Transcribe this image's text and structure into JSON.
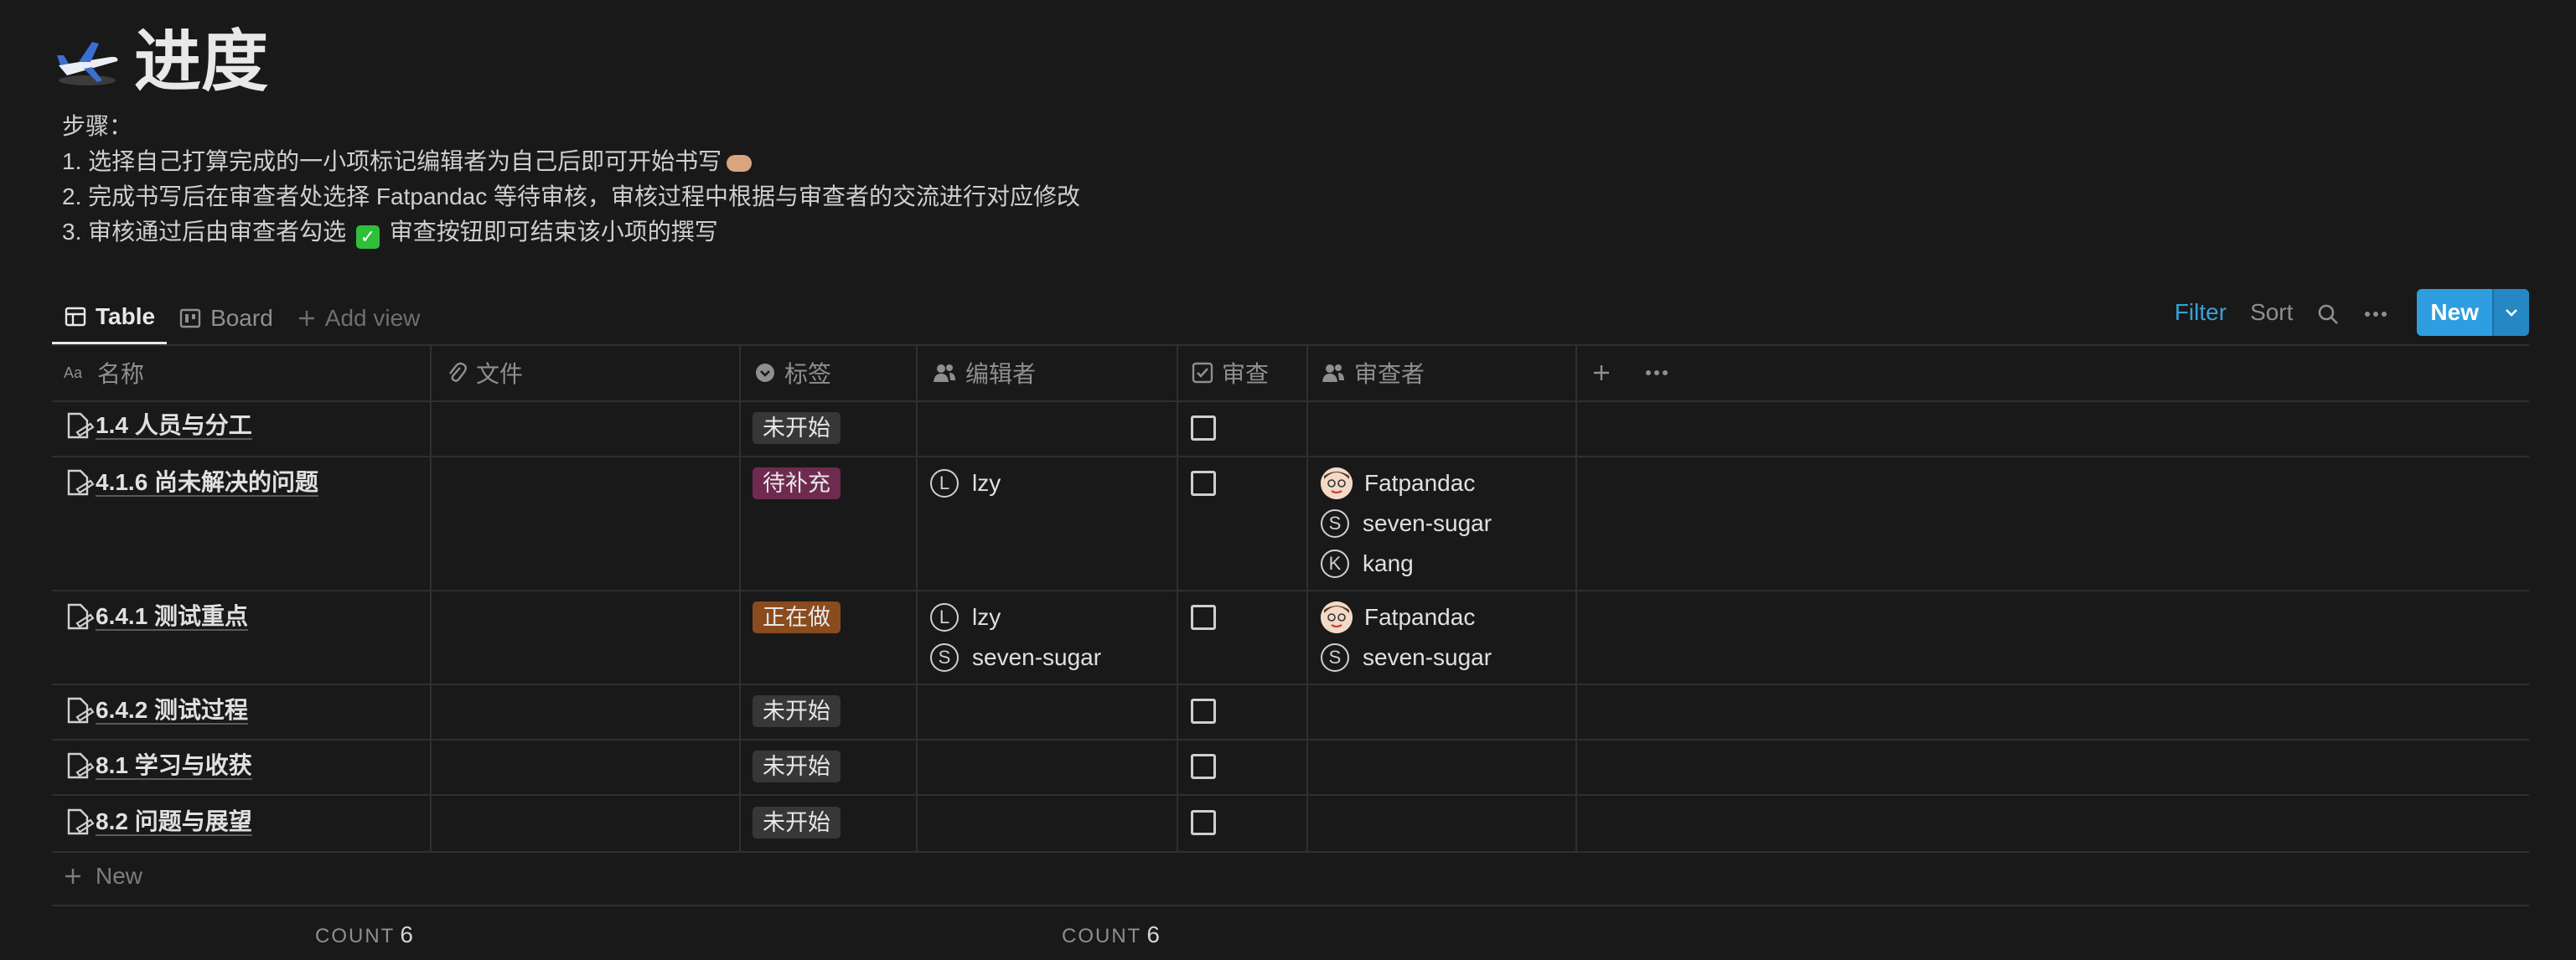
{
  "page": {
    "icon": "airplane-icon",
    "title": "进度",
    "description": {
      "heading": "步骤：",
      "step1": "1. 选择自己打算完成的一小项标记编辑者为自己后即可开始书写",
      "step2": "2. 完成书写后在审查者处选择 Fatpandac 等待审核，审核过程中根据与审查者的交流进行对应修改",
      "step3_a": "3. 审核通过后由审查者勾选",
      "step3_b": "审查按钮即可结束该小项的撰写"
    }
  },
  "views": {
    "table": "Table",
    "board": "Board",
    "add_view": "Add view"
  },
  "toolbar": {
    "filter": "Filter",
    "sort": "Sort",
    "new": "New"
  },
  "columns": {
    "name": "名称",
    "file": "文件",
    "tag": "标签",
    "editor": "编辑者",
    "review": "审查",
    "reviewer": "审查者"
  },
  "tag_colors": {
    "未开始": "#373737",
    "待补充": "#6e2a4f",
    "正在做": "#8a4b1e"
  },
  "rows": [
    {
      "name": "1.4 人员与分工",
      "tag": "未开始",
      "editors": [],
      "reviewers": []
    },
    {
      "name": "4.1.6 尚未解决的问题",
      "tag": "待补充",
      "editors": [
        {
          "initial": "L",
          "name": "lzy"
        }
      ],
      "reviewers": [
        {
          "initial": "",
          "name": "Fatpandac"
        },
        {
          "initial": "S",
          "name": "seven-sugar"
        },
        {
          "initial": "K",
          "name": "kang"
        }
      ]
    },
    {
      "name": "6.4.1 测试重点",
      "tag": "正在做",
      "editors": [
        {
          "initial": "L",
          "name": "lzy"
        },
        {
          "initial": "S",
          "name": "seven-sugar"
        }
      ],
      "reviewers": [
        {
          "initial": "",
          "name": "Fatpandac"
        },
        {
          "initial": "S",
          "name": "seven-sugar"
        }
      ]
    },
    {
      "name": "6.4.2 测试过程",
      "tag": "未开始",
      "editors": [],
      "reviewers": []
    },
    {
      "name": "8.1 学习与收获",
      "tag": "未开始",
      "editors": [],
      "reviewers": []
    },
    {
      "name": "8.2 问题与展望",
      "tag": "未开始",
      "editors": [],
      "reviewers": []
    }
  ],
  "new_row": "New",
  "footer": {
    "count_label": "COUNT",
    "count_name": "6",
    "count_tag": "6"
  }
}
